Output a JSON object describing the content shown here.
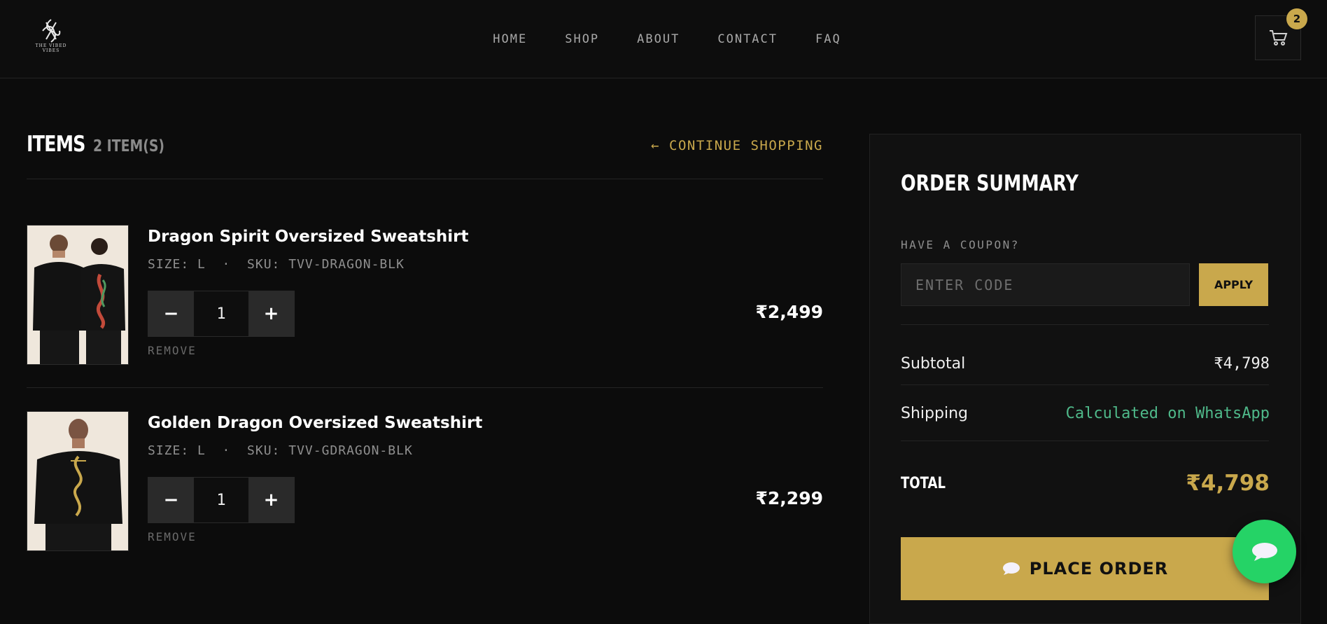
{
  "header": {
    "logo_text": "THE VIBED VIBES",
    "nav": [
      "HOME",
      "SHOP",
      "ABOUT",
      "CONTACT",
      "FAQ"
    ],
    "cart_count": "2",
    "cart_icon": "cart-icon"
  },
  "cart": {
    "title": "ITEMS",
    "count_label": "2 ITEM(S)",
    "continue_label": "← CONTINUE SHOPPING",
    "items": [
      {
        "name": "Dragon Spirit Oversized Sweatshirt",
        "meta": "SIZE: L  ·  SKU: TVV-DRAGON-BLK",
        "qty": "1",
        "minus": "−",
        "plus": "+",
        "remove": "REMOVE",
        "price": "₹2,499"
      },
      {
        "name": "Golden Dragon Oversized Sweatshirt",
        "meta": "SIZE: L  ·  SKU: TVV-GDRAGON-BLK",
        "qty": "1",
        "minus": "−",
        "plus": "+",
        "remove": "REMOVE",
        "price": "₹2,299"
      }
    ]
  },
  "summary": {
    "title": "ORDER SUMMARY",
    "coupon_label": "HAVE A COUPON?",
    "coupon_placeholder": "ENTER CODE",
    "apply_label": "APPLY",
    "subtotal_label": "Subtotal",
    "subtotal_value": "₹4,798",
    "shipping_label": "Shipping",
    "shipping_value": "Calculated on WhatsApp",
    "total_label": "TOTAL",
    "total_value": "₹4,798",
    "place_order_label": "PLACE ORDER"
  },
  "colors": {
    "accent": "#c9a84c",
    "background": "#0c0c0c",
    "panel": "#111111",
    "shipping_text": "#4fb98a",
    "whatsapp": "#25d366"
  }
}
